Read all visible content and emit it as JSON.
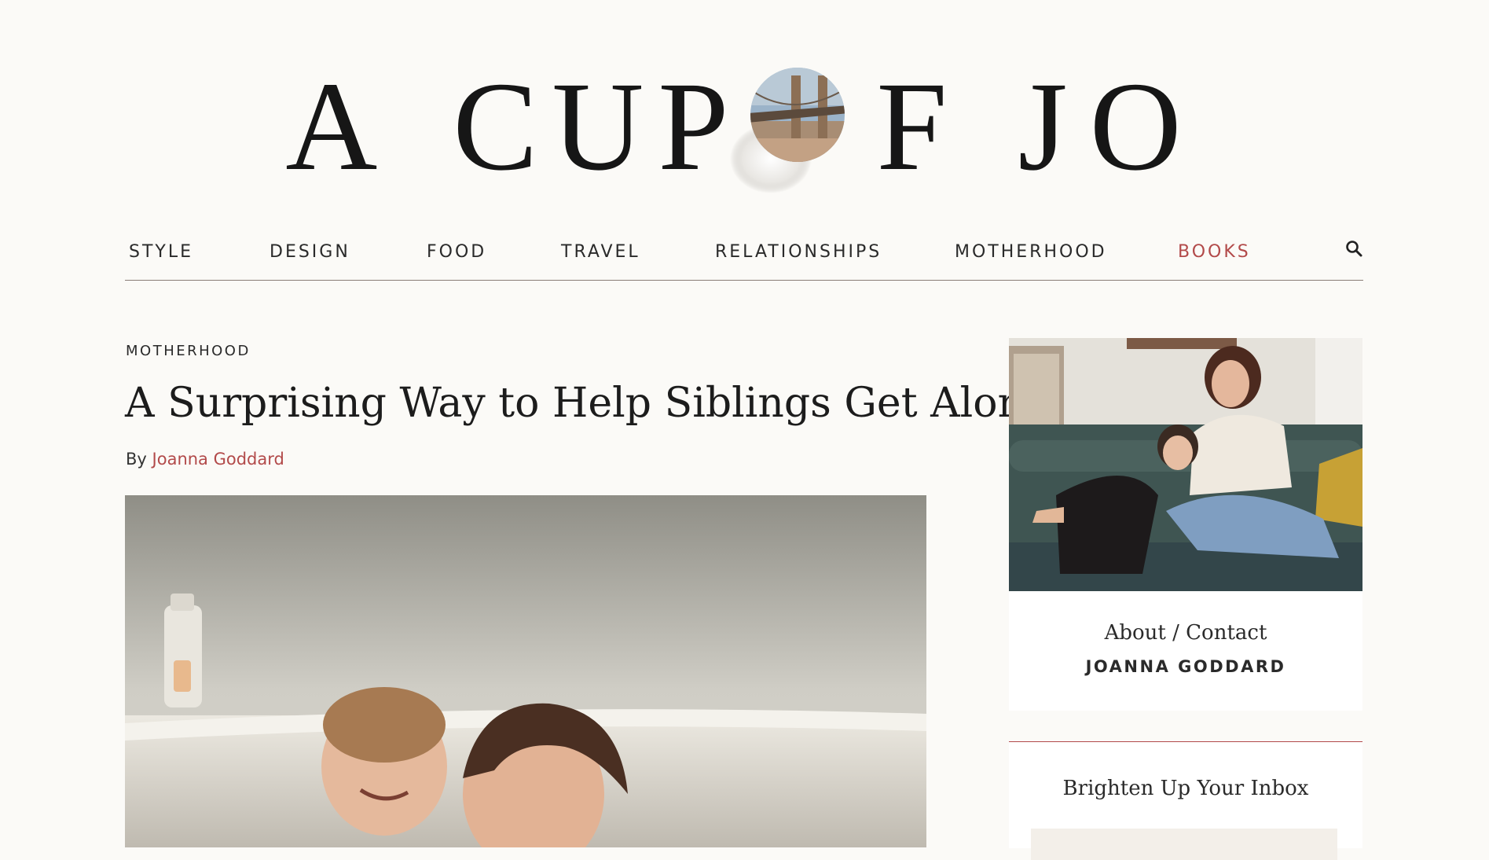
{
  "logo": {
    "part1": "A",
    "part2": "CUP",
    "part3": "F",
    "part4": "JO",
    "o_image": "brooklyn-bridge-photo"
  },
  "nav": {
    "items": [
      {
        "label": "STYLE"
      },
      {
        "label": "DESIGN"
      },
      {
        "label": "FOOD"
      },
      {
        "label": "TRAVEL"
      },
      {
        "label": "RELATIONSHIPS"
      },
      {
        "label": "MOTHERHOOD"
      },
      {
        "label": "BOOKS",
        "active": true
      }
    ],
    "search_icon": "search-icon"
  },
  "article": {
    "category": "MOTHERHOOD",
    "title": "A Surprising Way to Help Siblings Get Along",
    "by_label": "By",
    "author": "Joanna Goddard"
  },
  "sidebar": {
    "about_link": "About / Contact",
    "about_name": "JOANNA GODDARD",
    "newsletter_title": "Brighten Up Your Inbox"
  },
  "colors": {
    "background": "#fbfaf7",
    "accent": "#b24a4a",
    "text": "#222222"
  }
}
